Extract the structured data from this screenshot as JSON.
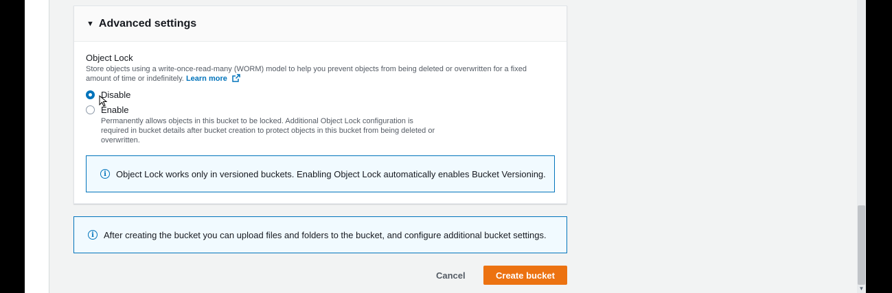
{
  "colors": {
    "accent": "#0073bb",
    "primary_button": "#ec7211",
    "info_background": "#f1faff"
  },
  "advanced_settings": {
    "title": "Advanced settings",
    "expanded": true
  },
  "object_lock": {
    "title": "Object Lock",
    "description": "Store objects using a write-once-read-many (WORM) model to help you prevent objects from being deleted or overwritten for a fixed amount of time or indefinitely.",
    "learn_more": "Learn more",
    "options": [
      {
        "label": "Disable",
        "selected": true
      },
      {
        "label": "Enable",
        "selected": false,
        "description": "Permanently allows objects in this bucket to be locked. Additional Object Lock configuration is required in bucket details after bucket creation to protect objects in this bucket from being deleted or overwritten."
      }
    ],
    "info": "Object Lock works only in versioned buckets. Enabling Object Lock automatically enables Bucket Versioning."
  },
  "footer_info": "After creating the bucket you can upload files and folders to the bucket, and configure additional bucket settings.",
  "actions": {
    "cancel": "Cancel",
    "create": "Create bucket"
  }
}
